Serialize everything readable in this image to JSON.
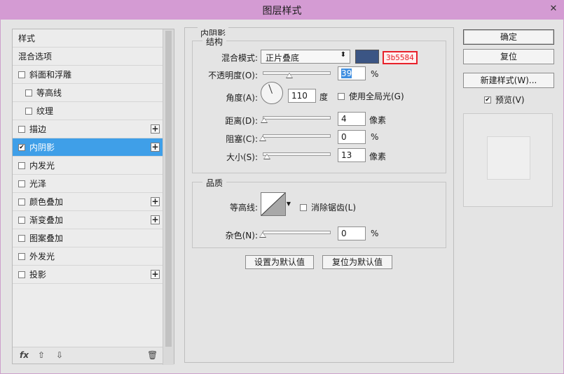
{
  "window": {
    "title": "图层样式",
    "close": "✕"
  },
  "styles": {
    "header": "样式",
    "blend_options": "混合选项",
    "items": [
      {
        "label": "斜面和浮雕",
        "checked": false,
        "indent": false,
        "plus": false
      },
      {
        "label": "等高线",
        "checked": false,
        "indent": true,
        "plus": false
      },
      {
        "label": "纹理",
        "checked": false,
        "indent": true,
        "plus": false
      },
      {
        "label": "描边",
        "checked": false,
        "indent": false,
        "plus": true
      },
      {
        "label": "内阴影",
        "checked": true,
        "indent": false,
        "plus": true,
        "selected": true
      },
      {
        "label": "内发光",
        "checked": false,
        "indent": false,
        "plus": false
      },
      {
        "label": "光泽",
        "checked": false,
        "indent": false,
        "plus": false
      },
      {
        "label": "颜色叠加",
        "checked": false,
        "indent": false,
        "plus": true
      },
      {
        "label": "渐变叠加",
        "checked": false,
        "indent": false,
        "plus": true
      },
      {
        "label": "图案叠加",
        "checked": false,
        "indent": false,
        "plus": false
      },
      {
        "label": "外发光",
        "checked": false,
        "indent": false,
        "plus": false
      },
      {
        "label": "投影",
        "checked": false,
        "indent": false,
        "plus": true
      }
    ],
    "footer": {
      "fx": "fx",
      "up": "⇧",
      "down": "⇩",
      "trash": "🗑"
    }
  },
  "panel": {
    "title": "内阴影",
    "structure": {
      "label": "结构",
      "blend_mode_label": "混合模式:",
      "blend_mode_value": "正片叠底",
      "color": "#3b5584",
      "color_hex": "3b5584",
      "opacity_label": "不透明度(O):",
      "opacity_value": "39",
      "opacity_unit": "%",
      "opacity_level": 0.39,
      "angle_label": "角度(A):",
      "angle_value": "110",
      "angle_unit": "度",
      "global_light_label": "使用全局光(G)",
      "global_light_checked": false,
      "distance_label": "距离(D):",
      "distance_value": "4",
      "distance_unit": "像素",
      "distance_level": 0.02,
      "choke_label": "阻塞(C):",
      "choke_value": "0",
      "choke_unit": "%",
      "choke_level": 0.0,
      "size_label": "大小(S):",
      "size_value": "13",
      "size_unit": "像素",
      "size_level": 0.06
    },
    "quality": {
      "label": "品质",
      "contour_label": "等高线:",
      "antialias_label": "消除锯齿(L)",
      "antialias_checked": false,
      "noise_label": "杂色(N):",
      "noise_value": "0",
      "noise_unit": "%",
      "noise_level": 0.0
    },
    "buttons": {
      "set_default": "设置为默认值",
      "reset_default": "复位为默认值"
    }
  },
  "actions": {
    "ok": "确定",
    "reset": "复位",
    "new_style": "新建样式(W)...",
    "preview_label": "预览(V)",
    "preview_checked": true
  }
}
